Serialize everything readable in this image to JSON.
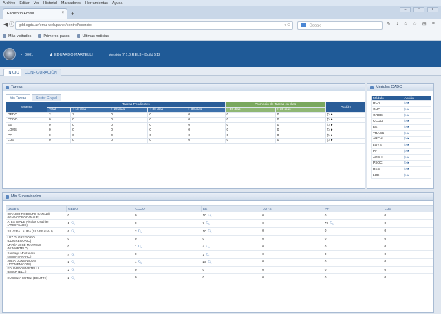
{
  "browser": {
    "menu": [
      "Archivo",
      "Editar",
      "Ver",
      "Historial",
      "Marcadores",
      "Herramientas",
      "Ayuda"
    ],
    "tab_title": "Escritorio Emisa",
    "tab_close": "×",
    "new_tab": "+",
    "url": "gdd.sgdu.ar/emu-web/panel/control/user.do",
    "search_placeholder": "Google",
    "bookmarks": [
      "Más visitados",
      "Primeros pasos",
      "Últimas noticias"
    ]
  },
  "header": {
    "user_id": "0001",
    "user_name": "EDUARDO MARTELLI",
    "version": "Versión 7.1.0.REL3 - Build 512"
  },
  "tabs": {
    "inicio": "INICIO",
    "config": "CONFIGURACIÓN"
  },
  "tareas": {
    "title": "Tareas",
    "tabs": [
      "Mis Tareas",
      "Sector Grupal"
    ],
    "headers": {
      "sistema": "Sistema",
      "pendientes": "Tareas Pendientes",
      "promedio": "Promedio de Tareas en días",
      "accion": "Acción",
      "total": "Total",
      "c1": "< 10 días",
      "c2": "> 20 días",
      "c3": "< 30 días",
      "c4": "> 30 días",
      "p1": "< 30 días",
      "p2": "> 30 días"
    },
    "rows": [
      {
        "sistema": "GEDO",
        "total": "2",
        "c1": "2",
        "c2": "0",
        "c3": "0",
        "c4": "0",
        "p1": "0",
        "p2": "0",
        "accion": "▷ ▸"
      },
      {
        "sistema": "CCOO",
        "total": "0",
        "c1": "0",
        "c2": "0",
        "c3": "0",
        "c4": "0",
        "p1": "0",
        "p2": "0",
        "accion": "▷ ▸"
      },
      {
        "sistema": "EE",
        "total": "0",
        "c1": "0",
        "c2": "0",
        "c3": "0",
        "c4": "0",
        "p1": "0",
        "p2": "0",
        "accion": "▷ ▸"
      },
      {
        "sistema": "LOYS",
        "total": "0",
        "c1": "0",
        "c2": "0",
        "c3": "0",
        "c4": "0",
        "p1": "0",
        "p2": "0",
        "accion": "▷ ▸"
      },
      {
        "sistema": "PF",
        "total": "0",
        "c1": "0",
        "c2": "0",
        "c3": "0",
        "c4": "0",
        "p1": "0",
        "p2": "0",
        "accion": "▷ ▸"
      },
      {
        "sistema": "LUE",
        "total": "0",
        "c1": "0",
        "c2": "0",
        "c3": "0",
        "c4": "0",
        "p1": "0",
        "p2": "0",
        "accion": "▷ ▸"
      }
    ]
  },
  "modulos": {
    "title": "Módulos GADC",
    "headers": {
      "modulo": "Módulo",
      "accion": "Acción"
    },
    "rows": [
      {
        "modulo": "RCA",
        "accion": "▷ ▸"
      },
      {
        "modulo": "GUF",
        "accion": "▷ ▸"
      },
      {
        "modulo": "GREC",
        "accion": "▷ ▸"
      },
      {
        "modulo": "CCOO",
        "accion": "▷ ▸"
      },
      {
        "modulo": "EE",
        "accion": "▷ ▸"
      },
      {
        "modulo": "TRACK",
        "accion": "▷ ▸"
      },
      {
        "modulo": "ARCH",
        "accion": "▷ ▸"
      },
      {
        "modulo": "LOYS",
        "accion": "▷ ▸"
      },
      {
        "modulo": "PF",
        "accion": "▷ ▸"
      },
      {
        "modulo": "ARCH",
        "accion": "▷ ▸"
      },
      {
        "modulo": "PSOC",
        "accion": "▷ ▸"
      },
      {
        "modulo": "REB",
        "accion": "▷ ▸"
      },
      {
        "modulo": "LUE",
        "accion": "▷ ▸"
      }
    ]
  },
  "supervisados": {
    "title": "Mis Supervisados",
    "headers": [
      "Usuario",
      "GEDO",
      "CCOO",
      "EE",
      "LOYS",
      "PF",
      "LUE"
    ],
    "rows": [
      {
        "user1": "IGNACIO RODOLFO CANALÉ",
        "user2": "(IGNACIOROCANALE)",
        "vals": [
          "0",
          "0",
          "10",
          "0",
          "0",
          "0"
        ],
        "mag": [
          false,
          false,
          true,
          false,
          false,
          false
        ]
      },
      {
        "user1": "ATESTSADE Nicolas Usuthier",
        "user2": "(ATESTSADE)",
        "vals": [
          "1",
          "0",
          "7",
          "0",
          "79",
          "0"
        ],
        "mag": [
          true,
          false,
          true,
          false,
          true,
          false
        ]
      },
      {
        "user1": "SILVERA LAURA (SILVERALAU)",
        "user2": "",
        "vals": [
          "6",
          "2",
          "10",
          "0",
          "0",
          "0"
        ],
        "mag": [
          true,
          true,
          true,
          false,
          false,
          false
        ]
      },
      {
        "user1": "LUZ DI GREGORIO",
        "user2": "(LDIGREGORIO)",
        "vals": [
          "0",
          "0",
          "0",
          "0",
          "0",
          "0"
        ],
        "mag": [
          false,
          false,
          false,
          false,
          false,
          false
        ]
      },
      {
        "user1": "MARÍA JOSÉ MARTELO",
        "user2": "(MJMARTELO)",
        "vals": [
          "0",
          "1",
          "4",
          "0",
          "0",
          "0"
        ],
        "mag": [
          false,
          true,
          true,
          false,
          false,
          false
        ]
      },
      {
        "user1": "Santiago Montanaro",
        "user2": "(SMONTANARO)",
        "vals": [
          "4",
          "0",
          "1",
          "0",
          "0",
          "0"
        ],
        "mag": [
          true,
          false,
          true,
          false,
          false,
          false
        ]
      },
      {
        "user1": "JULIA DOMENICONI",
        "user2": "(JDOMENICONI)",
        "vals": [
          "2",
          "4",
          "23",
          "0",
          "0",
          "0"
        ],
        "mag": [
          true,
          true,
          true,
          false,
          false,
          false
        ]
      },
      {
        "user1": "EDUARDO MARTELLI",
        "user2": "(EMARTELLI)",
        "vals": [
          "2",
          "0",
          "0",
          "0",
          "0",
          "0"
        ],
        "mag": [
          true,
          false,
          false,
          false,
          false,
          false
        ]
      },
      {
        "user1": "EUGENIA CUTINI (ECUTINI)",
        "user2": "",
        "vals": [
          "2",
          "0",
          "0",
          "0",
          "0",
          "0"
        ],
        "mag": [
          true,
          false,
          false,
          false,
          false,
          false
        ]
      }
    ]
  }
}
